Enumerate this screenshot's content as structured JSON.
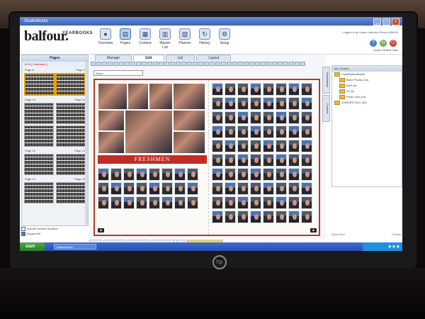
{
  "window": {
    "title": "StudioWorks"
  },
  "brand": {
    "name": "balfour.",
    "sub": "YEARBOOKS"
  },
  "toolbar": {
    "tools": [
      {
        "label": "Overview",
        "icon": "overview-icon"
      },
      {
        "label": "Pages",
        "icon": "pages-icon"
      },
      {
        "label": "Content",
        "icon": "content-icon"
      },
      {
        "label": "Master List",
        "icon": "master-list-icon"
      },
      {
        "label": "Planner",
        "icon": "planner-icon"
      },
      {
        "label": "History",
        "icon": "history-icon"
      },
      {
        "label": "Setup",
        "icon": "setup-icon"
      }
    ]
  },
  "header": {
    "user_info": "Logged in as Susan Valeria's Pieces (BM99)",
    "open_content_view": "Open Content View"
  },
  "left_panel": {
    "title": "Pages",
    "rows": [
      {
        "left": "Page 8",
        "right": "Page 9"
      },
      {
        "left": "Page 10",
        "right": "Page 11"
      },
      {
        "left": "Page 12",
        "right": "Page 13"
      },
      {
        "left": "Page 14",
        "right": "Page 15"
      }
    ],
    "selected_section": "8-20 [ Freshmen ]",
    "include_section_headers": "Include Section Headers",
    "expand_all": "Expand All"
  },
  "tabs": [
    "Manage",
    "Edit",
    "List",
    "Layout"
  ],
  "font_select": {
    "value": "Alleyo"
  },
  "spread": {
    "banner": "FRESHMEN"
  },
  "status_bar": {
    "zoom": "62%",
    "coord1": "X34.2 Y18.9",
    "coord2": "X63.11 Y8.2",
    "coord3": "W22.8 H18.0",
    "zero": "0",
    "ready": "Ready to Publish"
  },
  "right_panel": {
    "side_tabs": [
      "Annotations",
      "Content"
    ],
    "header": "My Content",
    "root": "ClydeBolteaNavita",
    "folders": [
      "Band Photos (16)",
      "MAS (6)",
      "P2 (6)",
      "Photo club (18)",
      "JUNIORS 2010 (36)"
    ],
    "footer_left": "Open Find",
    "footer_right": "2 Items"
  },
  "taskbar": {
    "start": "start",
    "app": "StudioWorks",
    "time": ""
  }
}
